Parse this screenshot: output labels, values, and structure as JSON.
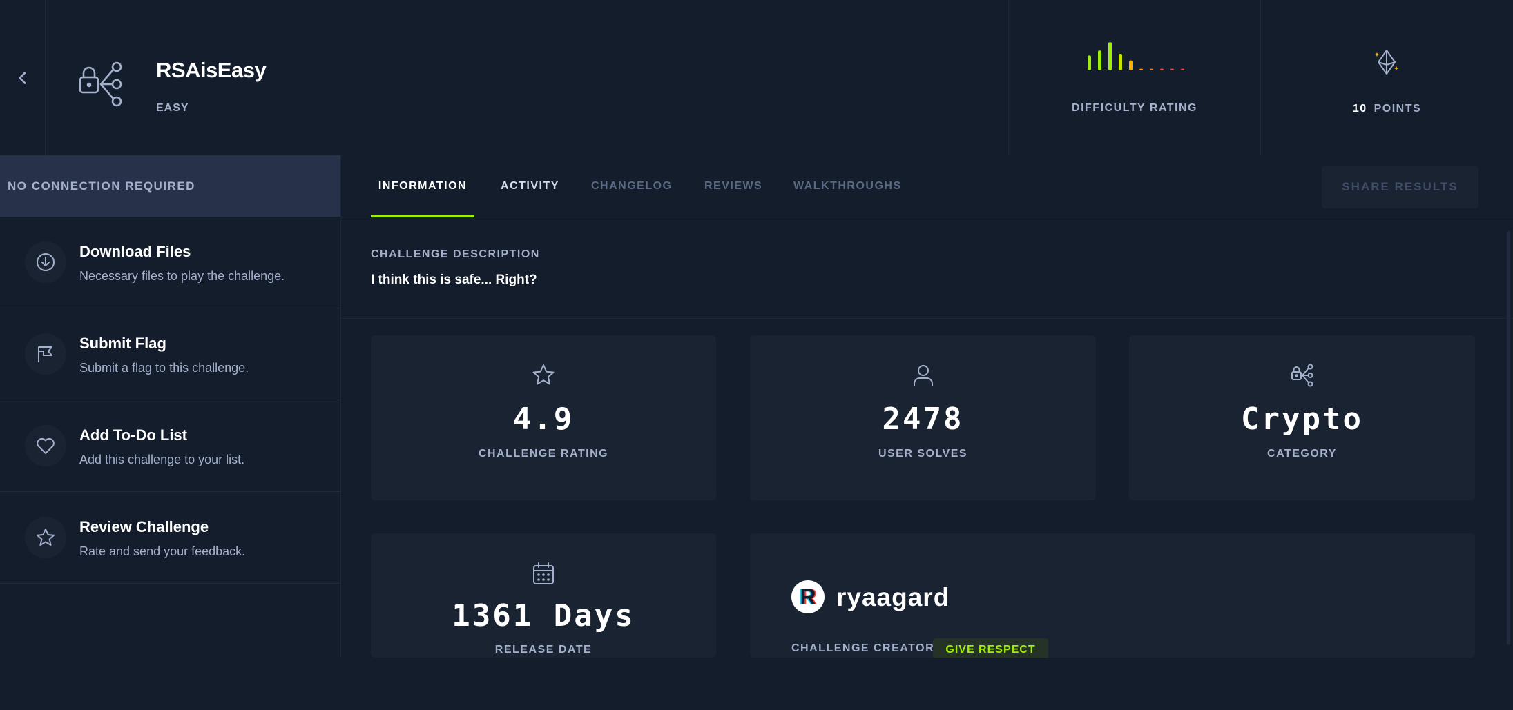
{
  "header": {
    "name": "RSAisEasy",
    "difficulty": "EASY",
    "difficulty_label": "DIFFICULTY RATING",
    "points_value": "10",
    "points_label": "POINTS"
  },
  "difficulty_bars": [
    {
      "level": 0.45,
      "color": "#9fef00"
    },
    {
      "level": 0.6,
      "color": "#9fef00"
    },
    {
      "level": 0.85,
      "color": "#9fef00"
    },
    {
      "level": 0.5,
      "color": "#c6e400"
    },
    {
      "level": 0.3,
      "color": "#f5b300"
    },
    {
      "level": 0.05,
      "color": "#ff8a00"
    },
    {
      "level": 0.05,
      "color": "#ff6a00"
    },
    {
      "level": 0.05,
      "color": "#ff3e3e"
    },
    {
      "level": 0.05,
      "color": "#ff3e3e"
    },
    {
      "level": 0.05,
      "color": "#ff3e3e"
    }
  ],
  "sidebar": {
    "connection": "NO CONNECTION REQUIRED",
    "items": [
      {
        "title": "Download Files",
        "subtitle": "Necessary files to play the challenge.",
        "icon": "download-icon"
      },
      {
        "title": "Submit Flag",
        "subtitle": "Submit a flag to this challenge.",
        "icon": "flag-icon"
      },
      {
        "title": "Add To-Do List",
        "subtitle": "Add this challenge to your list.",
        "icon": "heart-icon"
      },
      {
        "title": "Review Challenge",
        "subtitle": "Rate and send your feedback.",
        "icon": "star-icon"
      }
    ]
  },
  "tabs": [
    {
      "label": "INFORMATION",
      "state": "active"
    },
    {
      "label": "ACTIVITY",
      "state": "normal"
    },
    {
      "label": "CHANGELOG",
      "state": "dim"
    },
    {
      "label": "REVIEWS",
      "state": "dim"
    },
    {
      "label": "WALKTHROUGHS",
      "state": "dim"
    }
  ],
  "share_label": "SHARE RESULTS",
  "description": {
    "heading": "CHALLENGE DESCRIPTION",
    "text": "I think this is safe... Right?"
  },
  "stats": [
    {
      "value": "4.9",
      "label": "CHALLENGE RATING",
      "icon": "star-icon"
    },
    {
      "value": "2478",
      "label": "USER SOLVES",
      "icon": "user-icon"
    },
    {
      "value": "Crypto",
      "label": "CATEGORY",
      "icon": "crypto-category-icon"
    },
    {
      "value": "1361 Days",
      "label": "RELEASE DATE",
      "icon": "calendar-icon"
    }
  ],
  "creator": {
    "avatar_letter": "R",
    "name": "ryaagard",
    "label": "CHALLENGE CREATOR",
    "respect_label": "GIVE RESPECT"
  },
  "colors": {
    "background": "#141d2b",
    "panel": "#1a2332",
    "accent": "#9fef00",
    "muted_text": "#a4b1cd"
  }
}
